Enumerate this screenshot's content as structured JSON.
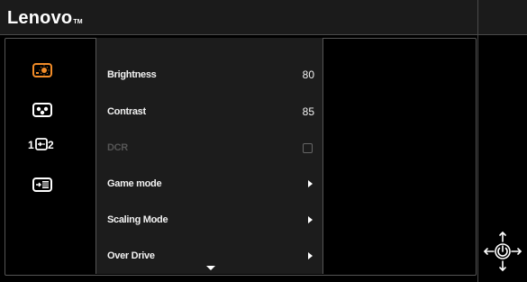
{
  "header": {
    "logo": "Lenovo",
    "logo_mark": "TM"
  },
  "sidebar": {
    "items": [
      {
        "icon": "brightness-contrast-icon",
        "selected": true
      },
      {
        "icon": "color-palette-icon",
        "selected": false
      },
      {
        "icon": "input-source-icon",
        "selected": false
      },
      {
        "icon": "menu-settings-icon",
        "selected": false
      }
    ],
    "input_label_1": "1",
    "input_label_2": "2"
  },
  "settings": {
    "rows": [
      {
        "label": "Brightness",
        "value": "80",
        "type": "value"
      },
      {
        "label": "Contrast",
        "value": "85",
        "type": "value"
      },
      {
        "label": "DCR",
        "type": "checkbox",
        "disabled": true,
        "checked": false
      },
      {
        "label": "Game mode",
        "type": "submenu"
      },
      {
        "label": "Scaling Mode",
        "type": "submenu"
      },
      {
        "label": "Over Drive",
        "type": "submenu"
      }
    ]
  },
  "navigation": {
    "icon": "navigation-joystick-icon"
  },
  "colors": {
    "accent": "#f28c28",
    "panel": "#1c1c1c",
    "header": "#1b1b1b",
    "background": "#000000"
  }
}
